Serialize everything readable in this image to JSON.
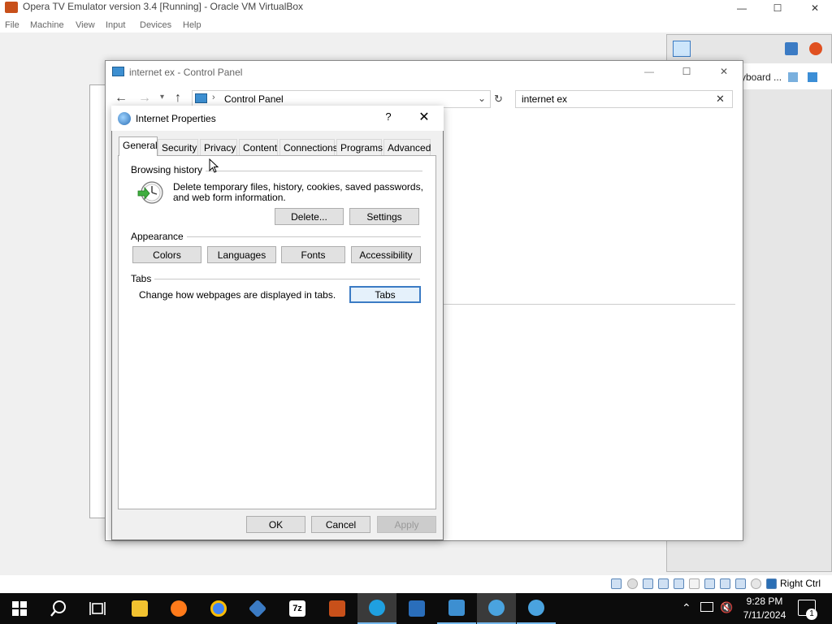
{
  "vbox": {
    "title": "Opera TV Emulator version 3.4 [Running] - Oracle VM VirtualBox",
    "menu": [
      "File",
      "Machine",
      "View",
      "Input",
      "Devices",
      "Help"
    ],
    "status_host_key": "Right Ctrl"
  },
  "bg_window": {
    "text": "yboard ..."
  },
  "control_panel": {
    "title": "internet ex - Control Panel",
    "address": "Control Panel",
    "search_value": "internet ex"
  },
  "dialog": {
    "title": "Internet Properties",
    "help": "?",
    "tabs": [
      "General",
      "Security",
      "Privacy",
      "Content",
      "Connections",
      "Programs",
      "Advanced"
    ],
    "active_tab": "General",
    "browsing_history": {
      "label": "Browsing history",
      "text_line1": "Delete temporary files, history, cookies, saved passwords,",
      "text_line2": "and web form information.",
      "delete": "Delete...",
      "settings": "Settings"
    },
    "appearance": {
      "label": "Appearance",
      "colors": "Colors",
      "languages": "Languages",
      "fonts": "Fonts",
      "accessibility": "Accessibility"
    },
    "tabs_group": {
      "label": "Tabs",
      "text": "Change how webpages are displayed in tabs.",
      "button": "Tabs"
    },
    "ok": "OK",
    "cancel": "Cancel",
    "apply": "Apply"
  },
  "taskbar": {
    "time": "9:28 PM",
    "date": "7/11/2024",
    "notification_count": "1",
    "apps": [
      {
        "name": "file-explorer",
        "color": "#f2c230"
      },
      {
        "name": "firefox",
        "color": "#ff7a1a"
      },
      {
        "name": "chrome",
        "color": "#4285f4"
      },
      {
        "name": "virtualbox",
        "color": "#3b7bc4"
      },
      {
        "name": "7zip",
        "color": "#ffffff"
      },
      {
        "name": "opera-tv",
        "color": "#c8501a"
      },
      {
        "name": "edge",
        "color": "#1fa0e0"
      },
      {
        "name": "app-blue",
        "color": "#2a6ebb"
      },
      {
        "name": "control-panel",
        "color": "#3d8fd1"
      },
      {
        "name": "internet-options-1",
        "color": "#4aa3df"
      },
      {
        "name": "internet-options-2",
        "color": "#4aa3df"
      }
    ]
  }
}
